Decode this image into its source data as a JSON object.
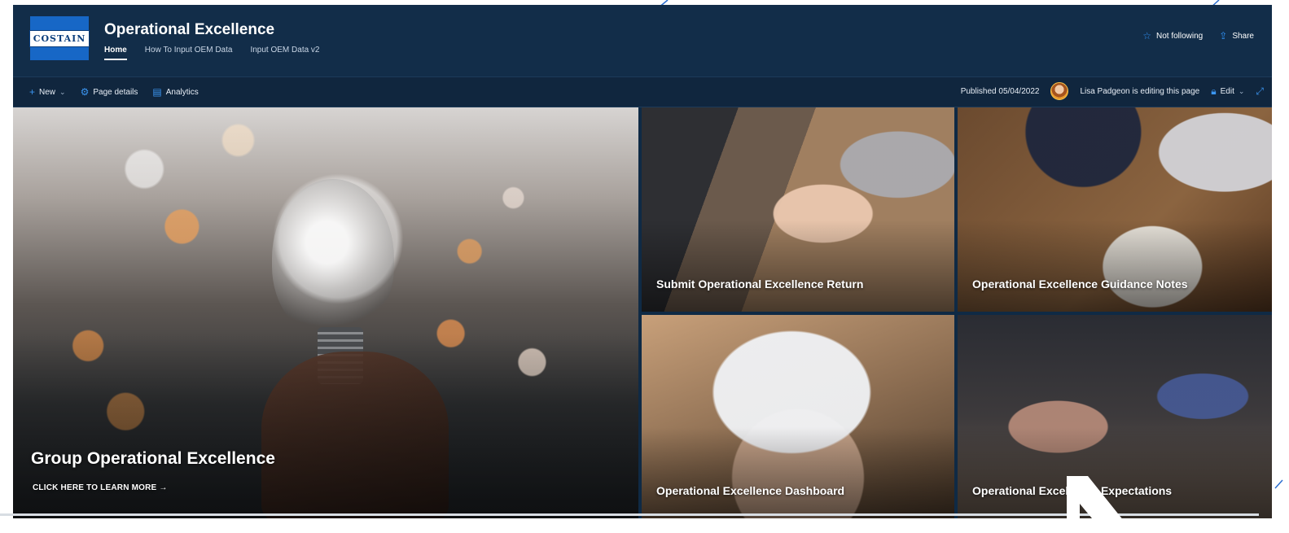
{
  "site": {
    "logo_text": "COSTAIN",
    "title": "Operational Excellence",
    "nav": [
      {
        "label": "Home",
        "active": true
      },
      {
        "label": "How To Input OEM Data",
        "active": false
      },
      {
        "label": "Input OEM Data v2",
        "active": false
      }
    ],
    "actions": {
      "follow": "Not following",
      "share": "Share"
    },
    "icons": {
      "follow": "star-icon",
      "share": "share-icon"
    },
    "colors": {
      "header_bg": "#122d49",
      "accent": "#2f8ff0",
      "logo_bg": "#1767c6"
    }
  },
  "commandbar": {
    "new_label": "New",
    "page_details_label": "Page details",
    "analytics_label": "Analytics",
    "published": "Published 05/04/2022",
    "editing": "Lisa Padgeon is editing this page",
    "edit_label": "Edit"
  },
  "hero": {
    "main": {
      "title": "Group Operational Excellence",
      "cta": "CLICK HERE TO LEARN MORE →"
    },
    "tiles": [
      {
        "label": "Submit Operational Excellence Return"
      },
      {
        "label": "Operational Excellence Guidance Notes"
      },
      {
        "label": "Operational Excellence Dashboard"
      },
      {
        "label": "Operational Excellence Expectations"
      }
    ]
  }
}
